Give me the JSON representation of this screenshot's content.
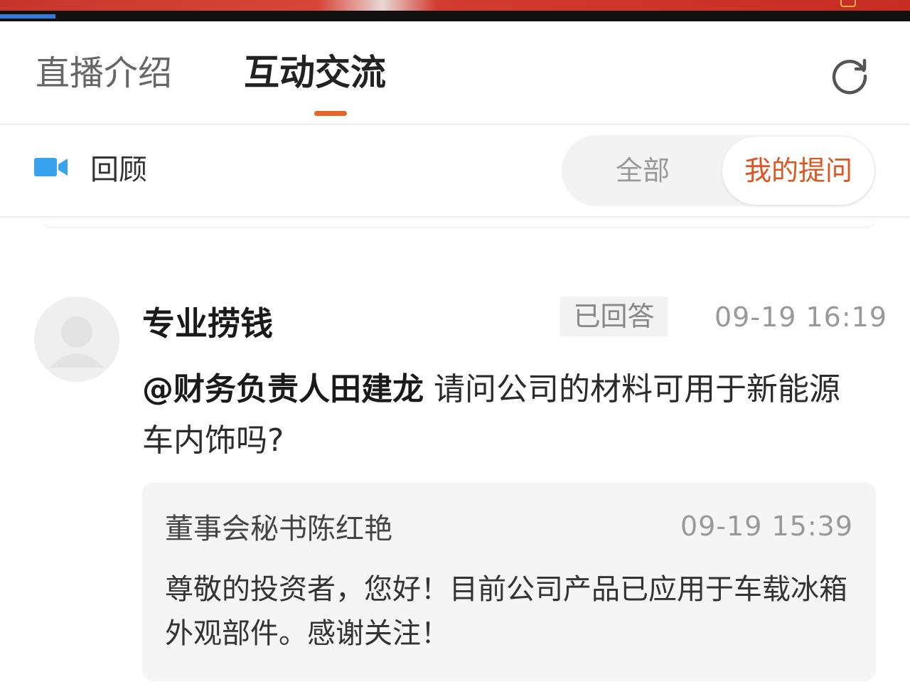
{
  "colors": {
    "accent": "#e2652a",
    "active_tab_text": "#222222",
    "inactive_tab_text": "#666666",
    "muted_text": "#999999",
    "video_icon": "#3aa3f0",
    "card_background": "#f5f5f6"
  },
  "tabs": {
    "intro_label": "直播介绍",
    "chat_label": "互动交流",
    "active": "互动交流"
  },
  "header": {
    "refresh_icon": "refresh-icon"
  },
  "filter": {
    "replay_icon": "video-camera-icon",
    "replay_label": "回顾",
    "all_label": "全部",
    "mine_label": "我的提问",
    "selected": "我的提问"
  },
  "post": {
    "avatar_icon": "default-avatar-icon",
    "username": "专业捞钱",
    "status": "已回答",
    "time": "09-19 16:19",
    "mention": "@财务负责人田建龙",
    "question": "请问公司的材料可用于新能源车内饰吗?",
    "reply": {
      "author": "董事会秘书陈红艳",
      "time": "09-19 15:39",
      "text": "尊敬的投资者，您好！目前公司产品已应用于车载冰箱外观部件。感谢关注！"
    }
  }
}
